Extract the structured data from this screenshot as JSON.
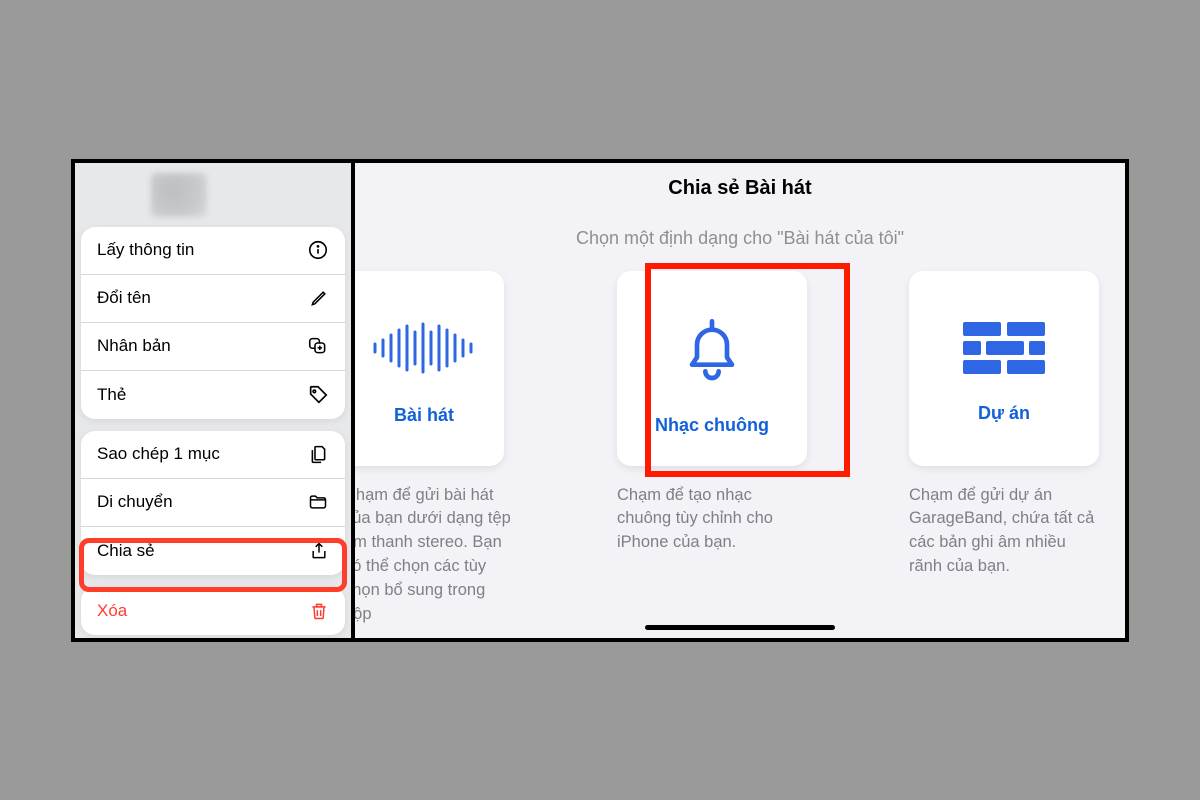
{
  "left": {
    "menu1": [
      {
        "label": "Lấy thông tin",
        "icon": "info"
      },
      {
        "label": "Đổi tên",
        "icon": "pencil"
      },
      {
        "label": "Nhân bản",
        "icon": "duplicate"
      },
      {
        "label": "Thẻ",
        "icon": "tag"
      }
    ],
    "menu2": [
      {
        "label": "Sao chép 1 mục",
        "icon": "copy"
      },
      {
        "label": "Di chuyển",
        "icon": "folder"
      },
      {
        "label": "Chia sẻ",
        "icon": "share"
      }
    ],
    "menu3": [
      {
        "label": "Xóa",
        "icon": "trash",
        "destructive": true
      }
    ]
  },
  "right": {
    "title": "Chia sẻ Bài hát",
    "subtitle": "Chọn một định dạng cho \"Bài hát của tôi\"",
    "cards": [
      {
        "label": "Bài hát",
        "desc": "Chạm để gửi bài hát của bạn dưới dạng tệp âm thanh stereo. Bạn có thể chọn các tùy chọn bổ sung trong hộp"
      },
      {
        "label": "Nhạc chuông",
        "desc": "Chạm để tạo nhạc chuông tùy chỉnh cho iPhone của bạn."
      },
      {
        "label": "Dự án",
        "desc": "Chạm để gửi dự án GarageBand, chứa tất cả các bản ghi âm nhiều rãnh của bạn."
      }
    ]
  },
  "highlighted_menu_item": "Chia sẻ",
  "highlighted_card": "Nhạc chuông"
}
